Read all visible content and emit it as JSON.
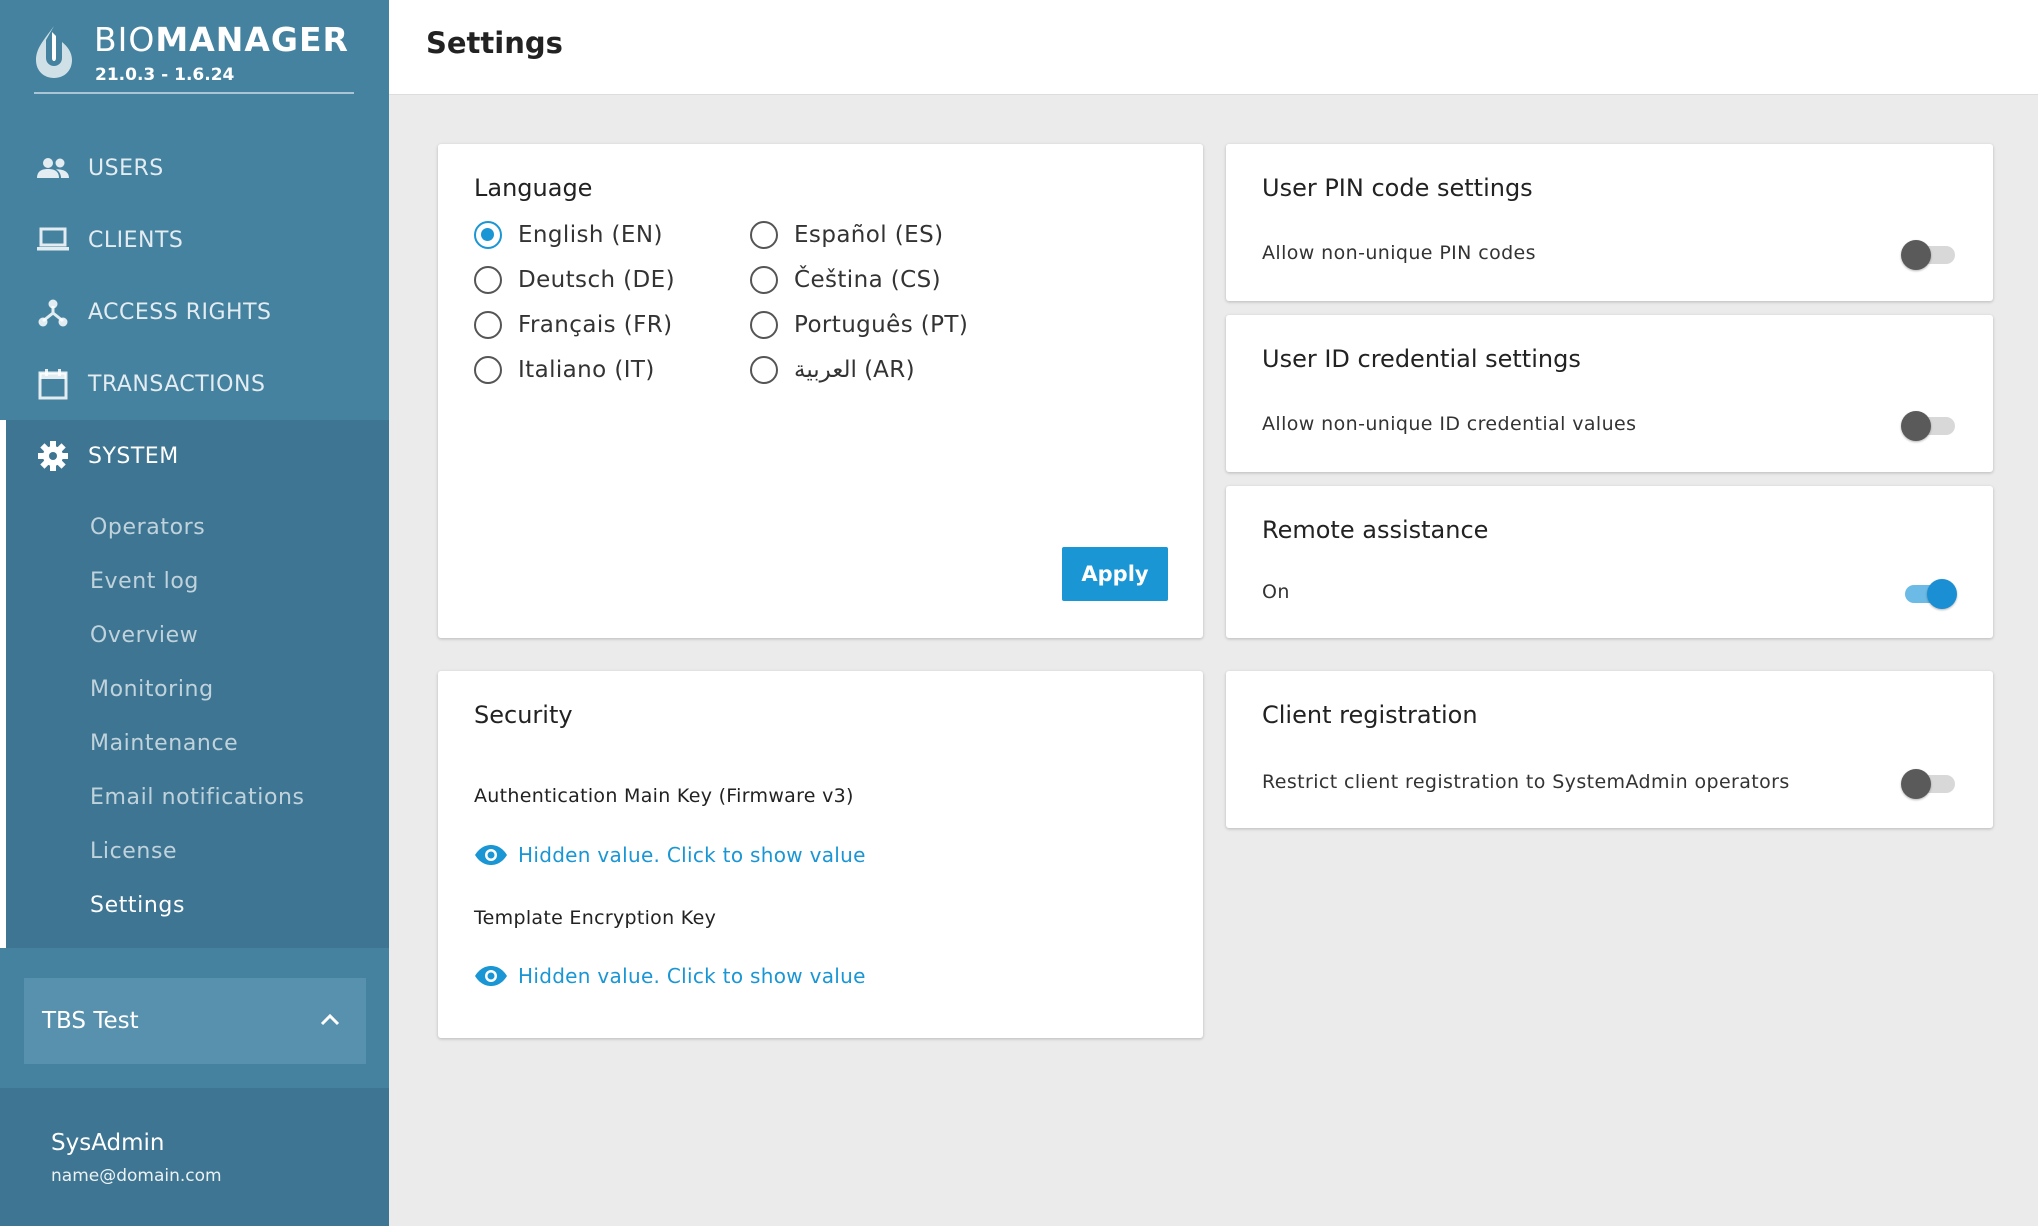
{
  "brand": {
    "name_light": "BIO",
    "name_bold": "MANAGER",
    "version": "21.0.3 - 1.6.24"
  },
  "nav": [
    {
      "label": "USERS",
      "icon": "users-icon"
    },
    {
      "label": "CLIENTS",
      "icon": "laptop-icon"
    },
    {
      "label": "ACCESS RIGHTS",
      "icon": "hierarchy-icon"
    },
    {
      "label": "TRANSACTIONS",
      "icon": "calendar-icon"
    }
  ],
  "system": {
    "label": "SYSTEM",
    "icon": "gear-icon",
    "items": [
      "Operators",
      "Event log",
      "Overview",
      "Monitoring",
      "Maintenance",
      "Email notifications",
      "License",
      "Settings"
    ],
    "active": "Settings"
  },
  "org": {
    "name": "TBS Test"
  },
  "user": {
    "name": "SysAdmin",
    "email": "name@domain.com"
  },
  "header": {
    "title": "Settings"
  },
  "language": {
    "title": "Language",
    "options": [
      "English (EN)",
      "Deutsch (DE)",
      "Français (FR)",
      "Italiano (IT)",
      "Español (ES)",
      "Čeština (CS)",
      "Português (PT)",
      "العربية (AR)"
    ],
    "selected": "English (EN)",
    "apply_label": "Apply"
  },
  "security": {
    "title": "Security",
    "keys": [
      {
        "label": "Authentication Main Key (Firmware v3)",
        "value_text": "Hidden value. Click to show value"
      },
      {
        "label": "Template Encryption Key",
        "value_text": "Hidden value. Click to show value"
      }
    ]
  },
  "pin": {
    "title": "User PIN code settings",
    "label": "Allow non-unique PIN codes",
    "enabled": false
  },
  "idcred": {
    "title": "User ID credential settings",
    "label": "Allow non-unique ID credential values",
    "enabled": false
  },
  "remote": {
    "title": "Remote assistance",
    "label": "On",
    "enabled": true
  },
  "clientreg": {
    "title": "Client registration",
    "label": "Restrict client registration to SystemAdmin operators",
    "enabled": false
  },
  "colors": {
    "accent": "#1a96d4",
    "sidebar": "#44829f",
    "sidebar_dark": "#3d7592"
  }
}
